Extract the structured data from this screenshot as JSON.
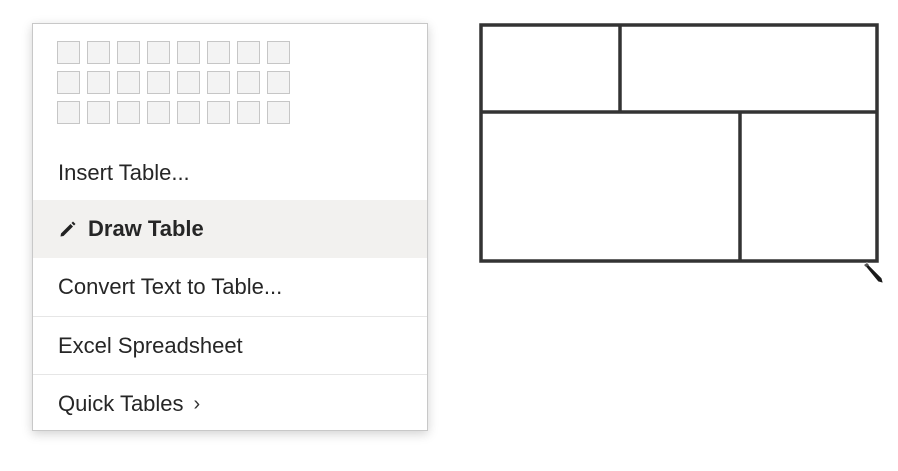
{
  "menu": {
    "grid": {
      "columns": 8,
      "rows": 3
    },
    "items": [
      {
        "label": "Insert Table..."
      },
      {
        "label": "Draw Table",
        "icon": "pencil-icon",
        "state": "hovered"
      },
      {
        "label": "Convert Text to Table..."
      },
      {
        "label": "Excel Spreadsheet"
      },
      {
        "label": "Quick Tables",
        "submenu_glyph": "›"
      }
    ]
  },
  "drawn_table": {
    "rows": 2,
    "top_row_cells": 2,
    "bottom_row_cells": 2
  },
  "cursor": {
    "icon": "pencil-cursor-icon"
  },
  "colors": {
    "hover_background": "#f2f1ef",
    "grid_cell_border": "#c6c6c6",
    "grid_cell_fill": "#f3f3f3",
    "table_stroke": "#333333"
  }
}
